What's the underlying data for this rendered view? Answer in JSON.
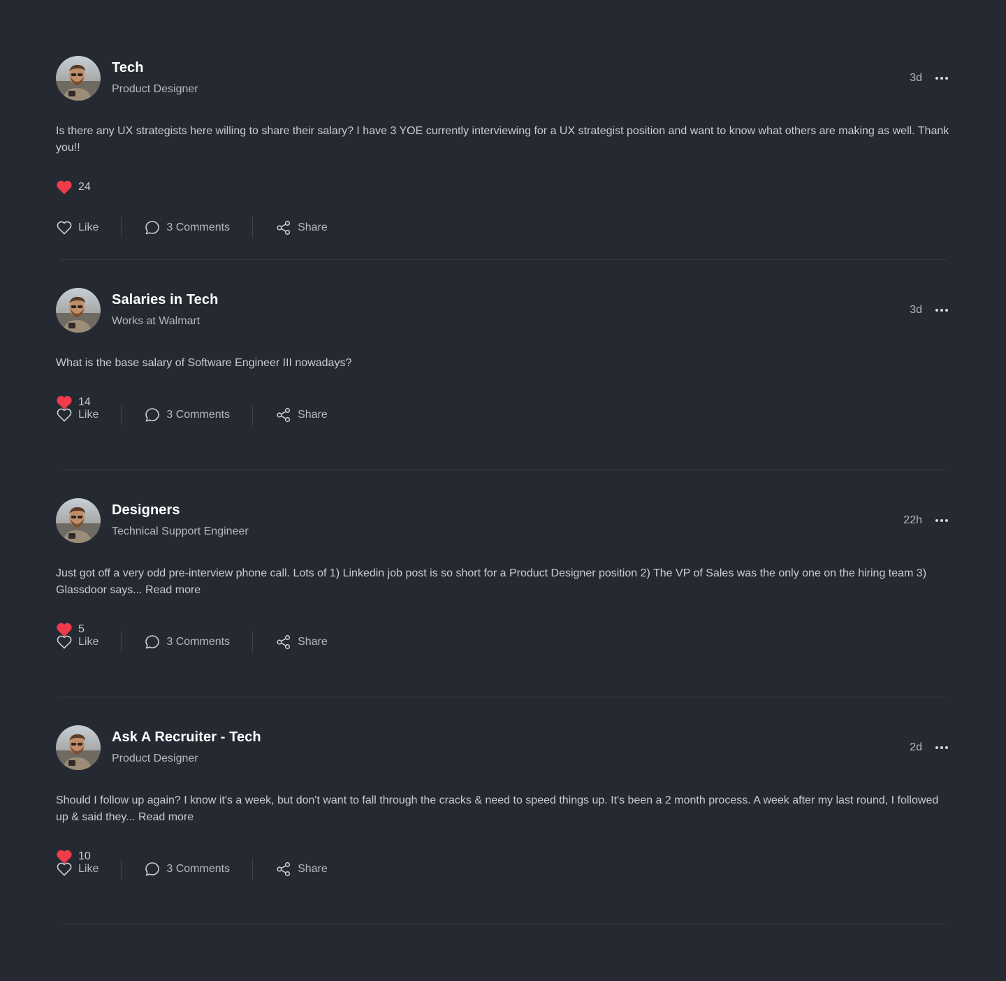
{
  "posts": [
    {
      "group": "Tech",
      "role": "Product Designer",
      "time": "3d",
      "body": "Is there any UX strategists here willing to share their salary? I have 3 YOE currently interviewing for a UX strategist position and want to know what others are making as well. Thank you!!",
      "likes": "24",
      "like_label": "Like",
      "comments_label": "3 Comments",
      "share_label": "Share"
    },
    {
      "group": "Salaries in Tech",
      "role": "Works at Walmart",
      "time": "3d",
      "body": "What is the base salary of Software Engineer III nowadays?",
      "likes": "14",
      "like_label": "Like",
      "comments_label": "3 Comments",
      "share_label": "Share"
    },
    {
      "group": "Designers",
      "role": "Technical Support Engineer",
      "time": "22h",
      "body": "Just got off a very odd pre-interview phone call. Lots of 1) Linkedin job post is so short for a Product Designer position 2) The VP of Sales was the only one on the hiring team 3) Glassdoor says... Read more",
      "likes": "5",
      "like_label": "Like",
      "comments_label": "3 Comments",
      "share_label": "Share"
    },
    {
      "group": "Ask A Recruiter - Tech",
      "role": "Product Designer",
      "time": "2d",
      "body": "Should I follow up again? I know it's a week, but don't want to fall through the cracks & need to speed things up. It's been a 2 month process. A week after my last round, I followed up & said they... Read more",
      "likes": "10",
      "like_label": "Like",
      "comments_label": "3 Comments",
      "share_label": "Share"
    }
  ],
  "icons": {
    "avatar": "avatar-photo",
    "more": "more-horizontal-icon",
    "liked": "heart-filled-icon",
    "like": "heart-outline-icon",
    "comment": "comment-bubble-icon",
    "share": "share-icon"
  },
  "colors": {
    "background": "#252a32",
    "heart": "#ef3b4a",
    "title": "#ffffff",
    "muted": "#b4b8be"
  }
}
